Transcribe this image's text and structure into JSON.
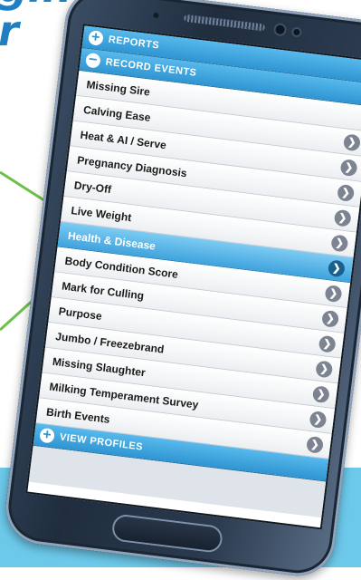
{
  "headline": {
    "line1": "ging",
    "line2": "r"
  },
  "app": {
    "sections": {
      "reports": "REPORTS",
      "record_events": "RECORD EVENTS",
      "view_profiles": "VIEW PROFILES"
    },
    "items": [
      "Missing Sire",
      "Calving Ease",
      "Heat & AI / Serve",
      "Pregnancy Diagnosis",
      "Dry-Off",
      "Live Weight",
      "Health & Disease",
      "Body Condition Score",
      "Mark for Culling",
      "Purpose",
      "Jumbo / Freezebrand",
      "Missing Slaughter",
      "Milking Temperament Survey",
      "Birth Events"
    ],
    "selected_item": "Health & Disease"
  },
  "colors": {
    "accent": "#2f95d2",
    "arrow": "#6cc04a",
    "band": "#6cc9ea",
    "headline": "#1f7fc0"
  }
}
